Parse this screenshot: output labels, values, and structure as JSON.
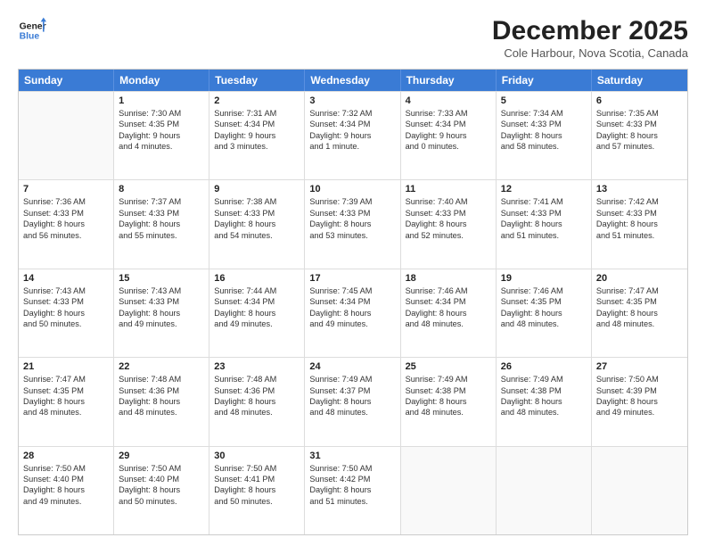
{
  "header": {
    "logo_line1": "General",
    "logo_line2": "Blue",
    "month": "December 2025",
    "location": "Cole Harbour, Nova Scotia, Canada"
  },
  "days_of_week": [
    "Sunday",
    "Monday",
    "Tuesday",
    "Wednesday",
    "Thursday",
    "Friday",
    "Saturday"
  ],
  "rows": [
    [
      {
        "day": "",
        "lines": []
      },
      {
        "day": "1",
        "lines": [
          "Sunrise: 7:30 AM",
          "Sunset: 4:35 PM",
          "Daylight: 9 hours",
          "and 4 minutes."
        ]
      },
      {
        "day": "2",
        "lines": [
          "Sunrise: 7:31 AM",
          "Sunset: 4:34 PM",
          "Daylight: 9 hours",
          "and 3 minutes."
        ]
      },
      {
        "day": "3",
        "lines": [
          "Sunrise: 7:32 AM",
          "Sunset: 4:34 PM",
          "Daylight: 9 hours",
          "and 1 minute."
        ]
      },
      {
        "day": "4",
        "lines": [
          "Sunrise: 7:33 AM",
          "Sunset: 4:34 PM",
          "Daylight: 9 hours",
          "and 0 minutes."
        ]
      },
      {
        "day": "5",
        "lines": [
          "Sunrise: 7:34 AM",
          "Sunset: 4:33 PM",
          "Daylight: 8 hours",
          "and 58 minutes."
        ]
      },
      {
        "day": "6",
        "lines": [
          "Sunrise: 7:35 AM",
          "Sunset: 4:33 PM",
          "Daylight: 8 hours",
          "and 57 minutes."
        ]
      }
    ],
    [
      {
        "day": "7",
        "lines": [
          "Sunrise: 7:36 AM",
          "Sunset: 4:33 PM",
          "Daylight: 8 hours",
          "and 56 minutes."
        ]
      },
      {
        "day": "8",
        "lines": [
          "Sunrise: 7:37 AM",
          "Sunset: 4:33 PM",
          "Daylight: 8 hours",
          "and 55 minutes."
        ]
      },
      {
        "day": "9",
        "lines": [
          "Sunrise: 7:38 AM",
          "Sunset: 4:33 PM",
          "Daylight: 8 hours",
          "and 54 minutes."
        ]
      },
      {
        "day": "10",
        "lines": [
          "Sunrise: 7:39 AM",
          "Sunset: 4:33 PM",
          "Daylight: 8 hours",
          "and 53 minutes."
        ]
      },
      {
        "day": "11",
        "lines": [
          "Sunrise: 7:40 AM",
          "Sunset: 4:33 PM",
          "Daylight: 8 hours",
          "and 52 minutes."
        ]
      },
      {
        "day": "12",
        "lines": [
          "Sunrise: 7:41 AM",
          "Sunset: 4:33 PM",
          "Daylight: 8 hours",
          "and 51 minutes."
        ]
      },
      {
        "day": "13",
        "lines": [
          "Sunrise: 7:42 AM",
          "Sunset: 4:33 PM",
          "Daylight: 8 hours",
          "and 51 minutes."
        ]
      }
    ],
    [
      {
        "day": "14",
        "lines": [
          "Sunrise: 7:43 AM",
          "Sunset: 4:33 PM",
          "Daylight: 8 hours",
          "and 50 minutes."
        ]
      },
      {
        "day": "15",
        "lines": [
          "Sunrise: 7:43 AM",
          "Sunset: 4:33 PM",
          "Daylight: 8 hours",
          "and 49 minutes."
        ]
      },
      {
        "day": "16",
        "lines": [
          "Sunrise: 7:44 AM",
          "Sunset: 4:34 PM",
          "Daylight: 8 hours",
          "and 49 minutes."
        ]
      },
      {
        "day": "17",
        "lines": [
          "Sunrise: 7:45 AM",
          "Sunset: 4:34 PM",
          "Daylight: 8 hours",
          "and 49 minutes."
        ]
      },
      {
        "day": "18",
        "lines": [
          "Sunrise: 7:46 AM",
          "Sunset: 4:34 PM",
          "Daylight: 8 hours",
          "and 48 minutes."
        ]
      },
      {
        "day": "19",
        "lines": [
          "Sunrise: 7:46 AM",
          "Sunset: 4:35 PM",
          "Daylight: 8 hours",
          "and 48 minutes."
        ]
      },
      {
        "day": "20",
        "lines": [
          "Sunrise: 7:47 AM",
          "Sunset: 4:35 PM",
          "Daylight: 8 hours",
          "and 48 minutes."
        ]
      }
    ],
    [
      {
        "day": "21",
        "lines": [
          "Sunrise: 7:47 AM",
          "Sunset: 4:35 PM",
          "Daylight: 8 hours",
          "and 48 minutes."
        ]
      },
      {
        "day": "22",
        "lines": [
          "Sunrise: 7:48 AM",
          "Sunset: 4:36 PM",
          "Daylight: 8 hours",
          "and 48 minutes."
        ]
      },
      {
        "day": "23",
        "lines": [
          "Sunrise: 7:48 AM",
          "Sunset: 4:36 PM",
          "Daylight: 8 hours",
          "and 48 minutes."
        ]
      },
      {
        "day": "24",
        "lines": [
          "Sunrise: 7:49 AM",
          "Sunset: 4:37 PM",
          "Daylight: 8 hours",
          "and 48 minutes."
        ]
      },
      {
        "day": "25",
        "lines": [
          "Sunrise: 7:49 AM",
          "Sunset: 4:38 PM",
          "Daylight: 8 hours",
          "and 48 minutes."
        ]
      },
      {
        "day": "26",
        "lines": [
          "Sunrise: 7:49 AM",
          "Sunset: 4:38 PM",
          "Daylight: 8 hours",
          "and 48 minutes."
        ]
      },
      {
        "day": "27",
        "lines": [
          "Sunrise: 7:50 AM",
          "Sunset: 4:39 PM",
          "Daylight: 8 hours",
          "and 49 minutes."
        ]
      }
    ],
    [
      {
        "day": "28",
        "lines": [
          "Sunrise: 7:50 AM",
          "Sunset: 4:40 PM",
          "Daylight: 8 hours",
          "and 49 minutes."
        ]
      },
      {
        "day": "29",
        "lines": [
          "Sunrise: 7:50 AM",
          "Sunset: 4:40 PM",
          "Daylight: 8 hours",
          "and 50 minutes."
        ]
      },
      {
        "day": "30",
        "lines": [
          "Sunrise: 7:50 AM",
          "Sunset: 4:41 PM",
          "Daylight: 8 hours",
          "and 50 minutes."
        ]
      },
      {
        "day": "31",
        "lines": [
          "Sunrise: 7:50 AM",
          "Sunset: 4:42 PM",
          "Daylight: 8 hours",
          "and 51 minutes."
        ]
      },
      {
        "day": "",
        "lines": []
      },
      {
        "day": "",
        "lines": []
      },
      {
        "day": "",
        "lines": []
      }
    ]
  ]
}
